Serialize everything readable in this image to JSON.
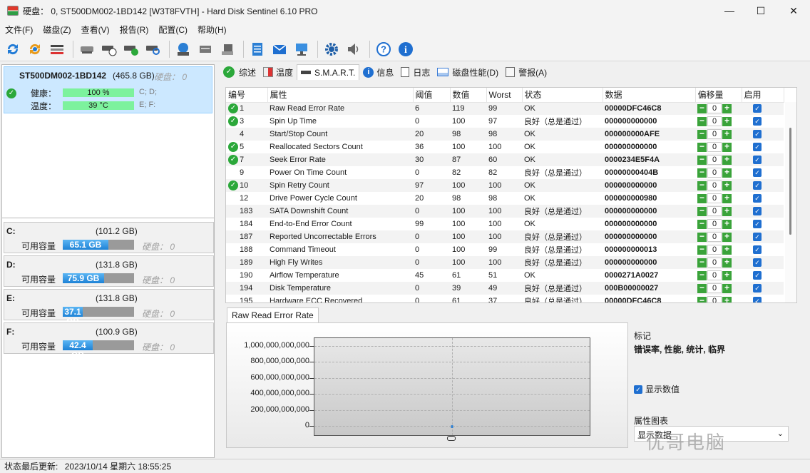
{
  "window": {
    "title": "硬盘： 0, ST500DM002-1BD142 [W3T8FVTH] - Hard Disk Sentinel 6.10 PRO",
    "minimize": "—",
    "maximize": "☐",
    "close": "✕"
  },
  "menu": [
    "文件(F)",
    "磁盘(Z)",
    "查看(V)",
    "报告(R)",
    "配置(C)",
    "帮助(H)"
  ],
  "disk": {
    "name": "ST500DM002-1BD142",
    "size": "(465.8 GB)",
    "disk_index": "硬盘： 0",
    "health_label": "健康：",
    "health_value": "100 %",
    "health_level": 100,
    "health_drives": "C; D;",
    "temp_label": "温度：",
    "temp_value": "39 °C",
    "temp_drives": "E; F:"
  },
  "partitions": [
    {
      "letter": "C:",
      "size": "(101.2 GB)",
      "free_label": "可用容量",
      "free": "65.1 GB",
      "fill": 0.64,
      "disk": "硬盘： 0"
    },
    {
      "letter": "D:",
      "size": "(131.8 GB)",
      "free_label": "可用容量",
      "free": "75.9 GB",
      "fill": 0.58,
      "disk": "硬盘： 0"
    },
    {
      "letter": "E:",
      "size": "(131.8 GB)",
      "free_label": "可用容量",
      "free": "37.1 GB",
      "fill": 0.28,
      "disk": "硬盘： 0"
    },
    {
      "letter": "F:",
      "size": "(100.9 GB)",
      "free_label": "可用容量",
      "free": "42.4 GB",
      "fill": 0.42,
      "disk": "硬盘： 0"
    }
  ],
  "tabs": [
    "综述",
    "温度",
    "S.M.A.R.T.",
    "信息",
    "日志",
    "磁盘性能(D)",
    "警报(A)"
  ],
  "smart": {
    "headers": [
      "编号",
      "属性",
      "阈值",
      "数值",
      "Worst",
      "状态",
      "数据",
      "偏移量",
      "启用"
    ],
    "rows": [
      {
        "id": "1",
        "ok": true,
        "name": "Raw Read Error Rate",
        "thr": "6",
        "val": "119",
        "worst": "99",
        "status": "OK",
        "data": "00000DFC46C8",
        "offset": "0"
      },
      {
        "id": "3",
        "ok": true,
        "name": "Spin Up Time",
        "thr": "0",
        "val": "100",
        "worst": "97",
        "status": "良好（总是通过）",
        "data": "000000000000",
        "offset": "0"
      },
      {
        "id": "4",
        "ok": false,
        "name": "Start/Stop Count",
        "thr": "20",
        "val": "98",
        "worst": "98",
        "status": "OK",
        "data": "000000000AFE",
        "offset": "0"
      },
      {
        "id": "5",
        "ok": true,
        "name": "Reallocated Sectors Count",
        "thr": "36",
        "val": "100",
        "worst": "100",
        "status": "OK",
        "data": "000000000000",
        "offset": "0"
      },
      {
        "id": "7",
        "ok": true,
        "name": "Seek Error Rate",
        "thr": "30",
        "val": "87",
        "worst": "60",
        "status": "OK",
        "data": "0000234E5F4A",
        "offset": "0"
      },
      {
        "id": "9",
        "ok": false,
        "name": "Power On Time Count",
        "thr": "0",
        "val": "82",
        "worst": "82",
        "status": "良好（总是通过）",
        "data": "00000000404B",
        "offset": "0"
      },
      {
        "id": "10",
        "ok": true,
        "name": "Spin Retry Count",
        "thr": "97",
        "val": "100",
        "worst": "100",
        "status": "OK",
        "data": "000000000000",
        "offset": "0"
      },
      {
        "id": "12",
        "ok": false,
        "name": "Drive Power Cycle Count",
        "thr": "20",
        "val": "98",
        "worst": "98",
        "status": "OK",
        "data": "000000000980",
        "offset": "0"
      },
      {
        "id": "183",
        "ok": false,
        "name": "SATA Downshift Count",
        "thr": "0",
        "val": "100",
        "worst": "100",
        "status": "良好（总是通过）",
        "data": "000000000000",
        "offset": "0"
      },
      {
        "id": "184",
        "ok": false,
        "name": "End-to-End Error Count",
        "thr": "99",
        "val": "100",
        "worst": "100",
        "status": "OK",
        "data": "000000000000",
        "offset": "0"
      },
      {
        "id": "187",
        "ok": false,
        "name": "Reported Uncorrectable Errors",
        "thr": "0",
        "val": "100",
        "worst": "100",
        "status": "良好（总是通过）",
        "data": "000000000000",
        "offset": "0"
      },
      {
        "id": "188",
        "ok": false,
        "name": "Command Timeout",
        "thr": "0",
        "val": "100",
        "worst": "99",
        "status": "良好（总是通过）",
        "data": "000000000013",
        "offset": "0"
      },
      {
        "id": "189",
        "ok": false,
        "name": "High Fly Writes",
        "thr": "0",
        "val": "100",
        "worst": "100",
        "status": "良好（总是通过）",
        "data": "000000000000",
        "offset": "0"
      },
      {
        "id": "190",
        "ok": false,
        "name": "Airflow Temperature",
        "thr": "45",
        "val": "61",
        "worst": "51",
        "status": "OK",
        "data": "0000271A0027",
        "offset": "0"
      },
      {
        "id": "194",
        "ok": false,
        "name": "Disk Temperature",
        "thr": "0",
        "val": "39",
        "worst": "49",
        "status": "良好（总是通过）",
        "data": "000B00000027",
        "offset": "0"
      },
      {
        "id": "195",
        "ok": false,
        "name": "Hardware ECC Recovered",
        "thr": "0",
        "val": "61",
        "worst": "37",
        "status": "良好（总是通过）",
        "data": "00000DFC46C8",
        "offset": "0"
      }
    ]
  },
  "chart": {
    "tab_label": "Raw Read Error Rate",
    "x_tick": "0",
    "legend_title": "标记",
    "legend_items": "错误率, 性能, 统计, 临界",
    "show_values_label": "显示数值",
    "attr_chart_label": "属性图表",
    "select_value": "显示数据"
  },
  "chart_data": {
    "type": "line",
    "title": "Raw Read Error Rate",
    "yticks": [
      "1,000,000,000,000",
      "800,000,000,000",
      "600,000,000,000",
      "400,000,000,000",
      "200,000,000,000",
      "0"
    ],
    "ylim": [
      0,
      1000000000000
    ],
    "series": [
      {
        "values": [
          0
        ]
      }
    ],
    "grid": true
  },
  "watermark": "优哥电脑",
  "status": {
    "label": "状态最后更新:",
    "value": "2023/10/14 星期六 18:55:25"
  }
}
